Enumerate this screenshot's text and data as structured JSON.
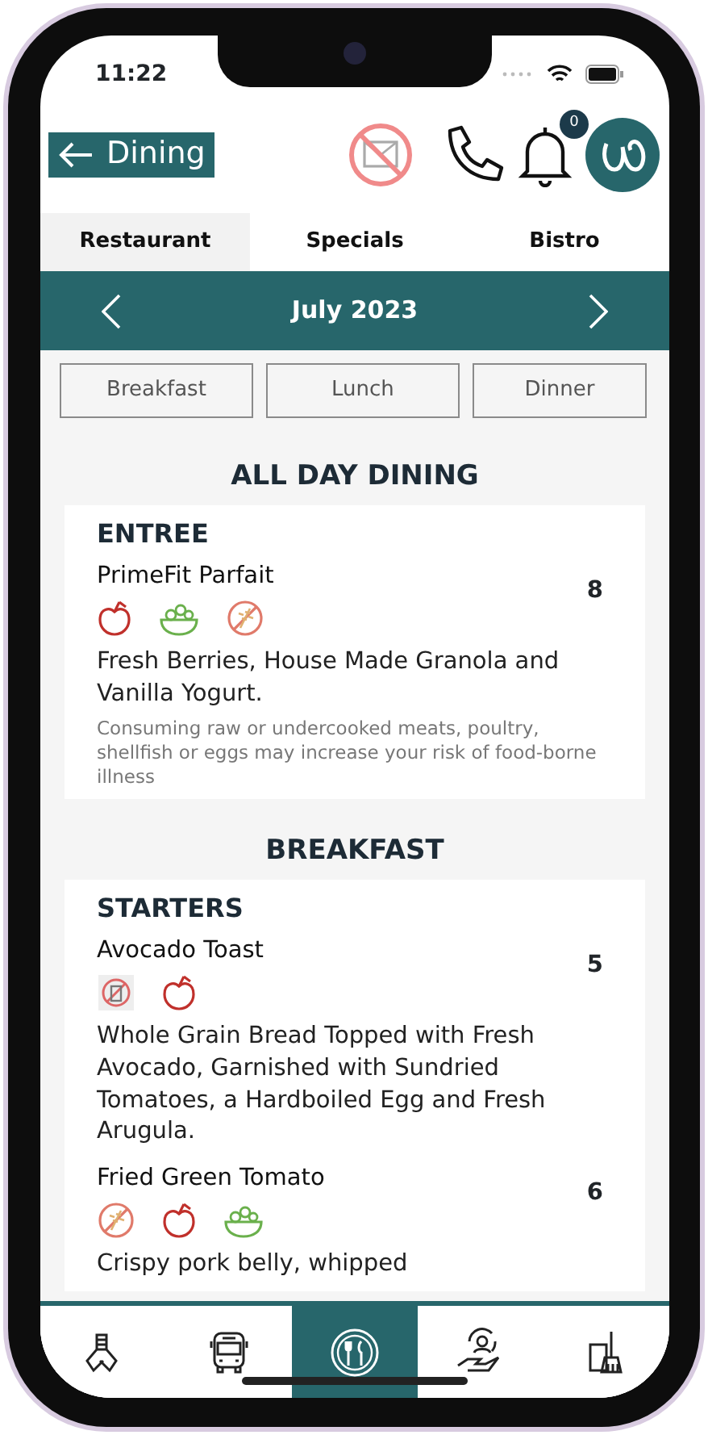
{
  "status_bar": {
    "time": "11:22"
  },
  "header": {
    "back_button": "Dining",
    "notification_count": "0"
  },
  "tabs": [
    {
      "label": "Restaurant",
      "selected": true
    },
    {
      "label": "Specials",
      "selected": false
    },
    {
      "label": "Bistro",
      "selected": false
    }
  ],
  "month_bar": {
    "label": "July 2023"
  },
  "meal_filters": [
    {
      "label": "Breakfast",
      "selected": false
    },
    {
      "label": "Lunch",
      "selected": false
    },
    {
      "label": "Dinner",
      "selected": false
    }
  ],
  "sections": [
    {
      "title": "ALL DAY DINING",
      "categories": [
        {
          "title": "ENTREE",
          "items": [
            {
              "name": "PrimeFit Parfait",
              "price": "8",
              "icons": [
                {
                  "kind": "apple"
                },
                {
                  "kind": "salad"
                },
                {
                  "kind": "no-wheat"
                }
              ],
              "description": "Fresh Berries, House Made Granola and Vanilla Yogurt.",
              "note": "Consuming raw or undercooked meats, poultry, shellfish or eggs may increase your risk of food-borne illness"
            }
          ]
        }
      ]
    },
    {
      "title": "BREAKFAST",
      "categories": [
        {
          "title": "STARTERS",
          "items": [
            {
              "name": "Avocado Toast",
              "price": "5",
              "icons": [
                {
                  "kind": "crossed-jar"
                },
                {
                  "kind": "apple"
                }
              ],
              "description": "Whole Grain Bread Topped with Fresh Avocado, Garnished with Sundried Tomatoes, a Hardboiled Egg and Fresh Arugula."
            },
            {
              "name": "Fried Green Tomato",
              "price": "6",
              "icons": [
                {
                  "kind": "no-wheat"
                },
                {
                  "kind": "apple"
                },
                {
                  "kind": "salad"
                }
              ],
              "description": "Crispy pork belly, whipped"
            }
          ]
        }
      ]
    }
  ],
  "bottom_nav": [
    {
      "kind": "hands",
      "selected": false
    },
    {
      "kind": "bus",
      "selected": false
    },
    {
      "kind": "dining",
      "selected": true
    },
    {
      "kind": "care",
      "selected": false
    },
    {
      "kind": "cleaning",
      "selected": false
    }
  ]
}
